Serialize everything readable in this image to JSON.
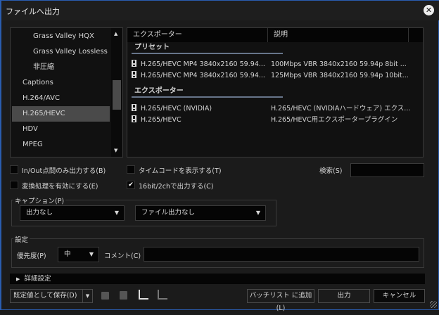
{
  "window": {
    "title": "ファイルへ出力",
    "close_icon": "close-icon"
  },
  "format_list": {
    "items": [
      {
        "label": "Grass Valley HQX",
        "sub": true
      },
      {
        "label": "Grass Valley Lossless",
        "sub": true
      },
      {
        "label": "非圧縮",
        "sub": true
      },
      {
        "label": "Captions",
        "sub": false
      },
      {
        "label": "H.264/AVC",
        "sub": false
      },
      {
        "label": "H.265/HEVC",
        "sub": false,
        "selected": true
      },
      {
        "label": "HDV",
        "sub": false
      },
      {
        "label": "MPEG",
        "sub": false
      }
    ]
  },
  "exporter_table": {
    "columns": [
      "エクスポーター",
      "説明"
    ],
    "preset_group": "プリセット",
    "presets": [
      {
        "name": "H.265/HEVC MP4 3840x2160 59.94...",
        "desc": "100Mbps VBR 3840x2160 59.94p 8bit ..."
      },
      {
        "name": "H.265/HEVC MP4 3840x2160 59.94...",
        "desc": "125Mbps VBR 3840x2160 59.94p 10bit..."
      }
    ],
    "exporter_group": "エクスポーター",
    "exporters": [
      {
        "name": "H.265/HEVC (NVIDIA)",
        "desc": "H.265/HEVC (NVIDIAハードウェア) エクス..."
      },
      {
        "name": "H.265/HEVC",
        "desc": "H.265/HEVC用エクスポータープラグイン"
      }
    ]
  },
  "options": {
    "inout": {
      "label": "In/Out点間のみ出力する(B)",
      "checked": false
    },
    "timecode": {
      "label": "タイムコードを表示する(T)",
      "checked": false
    },
    "convert": {
      "label": "変換処理を有効にする(E)",
      "checked": false
    },
    "bit16": {
      "label": "16bit/2chで出力する(C)",
      "checked": true,
      "check_mark": "✔"
    },
    "search_label": "検索(S)",
    "search_value": ""
  },
  "caption": {
    "legend": "キャプション(P)",
    "select1": "出力なし",
    "select2": "ファイル出力なし"
  },
  "settings": {
    "legend": "設定",
    "priority_label": "優先度(P)",
    "priority_value": "中",
    "comment_label": "コメント(C)",
    "comment_value": ""
  },
  "advanced": {
    "label": "詳細設定"
  },
  "footer": {
    "save_default": "既定値として保存(D)",
    "batch": "バッチリスト に追加(L)",
    "output": "出力",
    "cancel": "キャンセル"
  }
}
